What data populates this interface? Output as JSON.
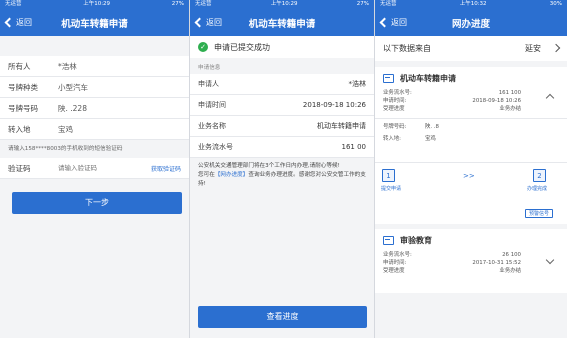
{
  "status": {
    "carrier": "无运营",
    "time": "上午10:29",
    "battery_s1": "27%",
    "battery_s2": "27%",
    "time_s3": "上午10:32",
    "battery_s3": "30%"
  },
  "screen1": {
    "back_label": "返回",
    "title": "机动车转籍申请",
    "owner_label": "所有人",
    "owner_value": "*浩林",
    "plate_type_label": "号牌种类",
    "plate_type_value": "小型汽车",
    "plate_no_label": "号牌号码",
    "plate_no_value": "陕.      .228",
    "dest_label": "转入地",
    "dest_value": "宝鸡",
    "sms_note": "请输入158****8003的手机收到的短信验证码",
    "code_label": "验证码",
    "code_placeholder": "请输入验证码",
    "get_code_label": "获取验证码",
    "next_button": "下一步"
  },
  "screen2": {
    "back_label": "返回",
    "title": "机动车转籍申请",
    "success_text": "申请已提交成功",
    "section_label": "申请信息",
    "applicant_label": "申请人",
    "applicant_value": "*浩林",
    "apply_time_label": "申请时间",
    "apply_time_value": "2018-09-18 10:26",
    "biz_name_label": "业务名称",
    "biz_name_value": "机动车转籍申请",
    "serial_label": "业务流水号",
    "serial_value": "161                  00",
    "notice_a": "公安机关交通管理部门将在3个工作日内办理,请耐心等候!",
    "notice_b": "您可在",
    "notice_link": "【网办进度】",
    "notice_c": "查询业务办理进度。感谢您对公安交管工作的支持!",
    "view_progress_button": "查看进度"
  },
  "screen3": {
    "back_label": "返回",
    "title": "网办进度",
    "source_label": "以下数据来自",
    "source_city": "延安",
    "card1": {
      "title": "机动车转籍申请",
      "serial_label": "业务流水号:",
      "serial_value": "161           100",
      "time_label": "申请时间:",
      "time_value": "2018-09-18 10:26",
      "progress_label": "受理进度",
      "progress_value": "业务办结",
      "plate_label": "号牌号码:",
      "plate_value": "陕.      .8",
      "dest_label": "转入地:",
      "dest_value": "宝鸡",
      "step1_no": "1",
      "step1_label": "提交申请",
      "arrows": ">>",
      "step2_no": "2",
      "step2_label": "办理完成",
      "tag_button": "预警信号"
    },
    "card2": {
      "title": "审验教育",
      "serial_label": "业务流水号:",
      "serial_value": "26         100",
      "time_label": "申请时间:",
      "time_value": "2017-10-31 15:52",
      "progress_label": "受理进度",
      "progress_value": "业务办结"
    }
  }
}
